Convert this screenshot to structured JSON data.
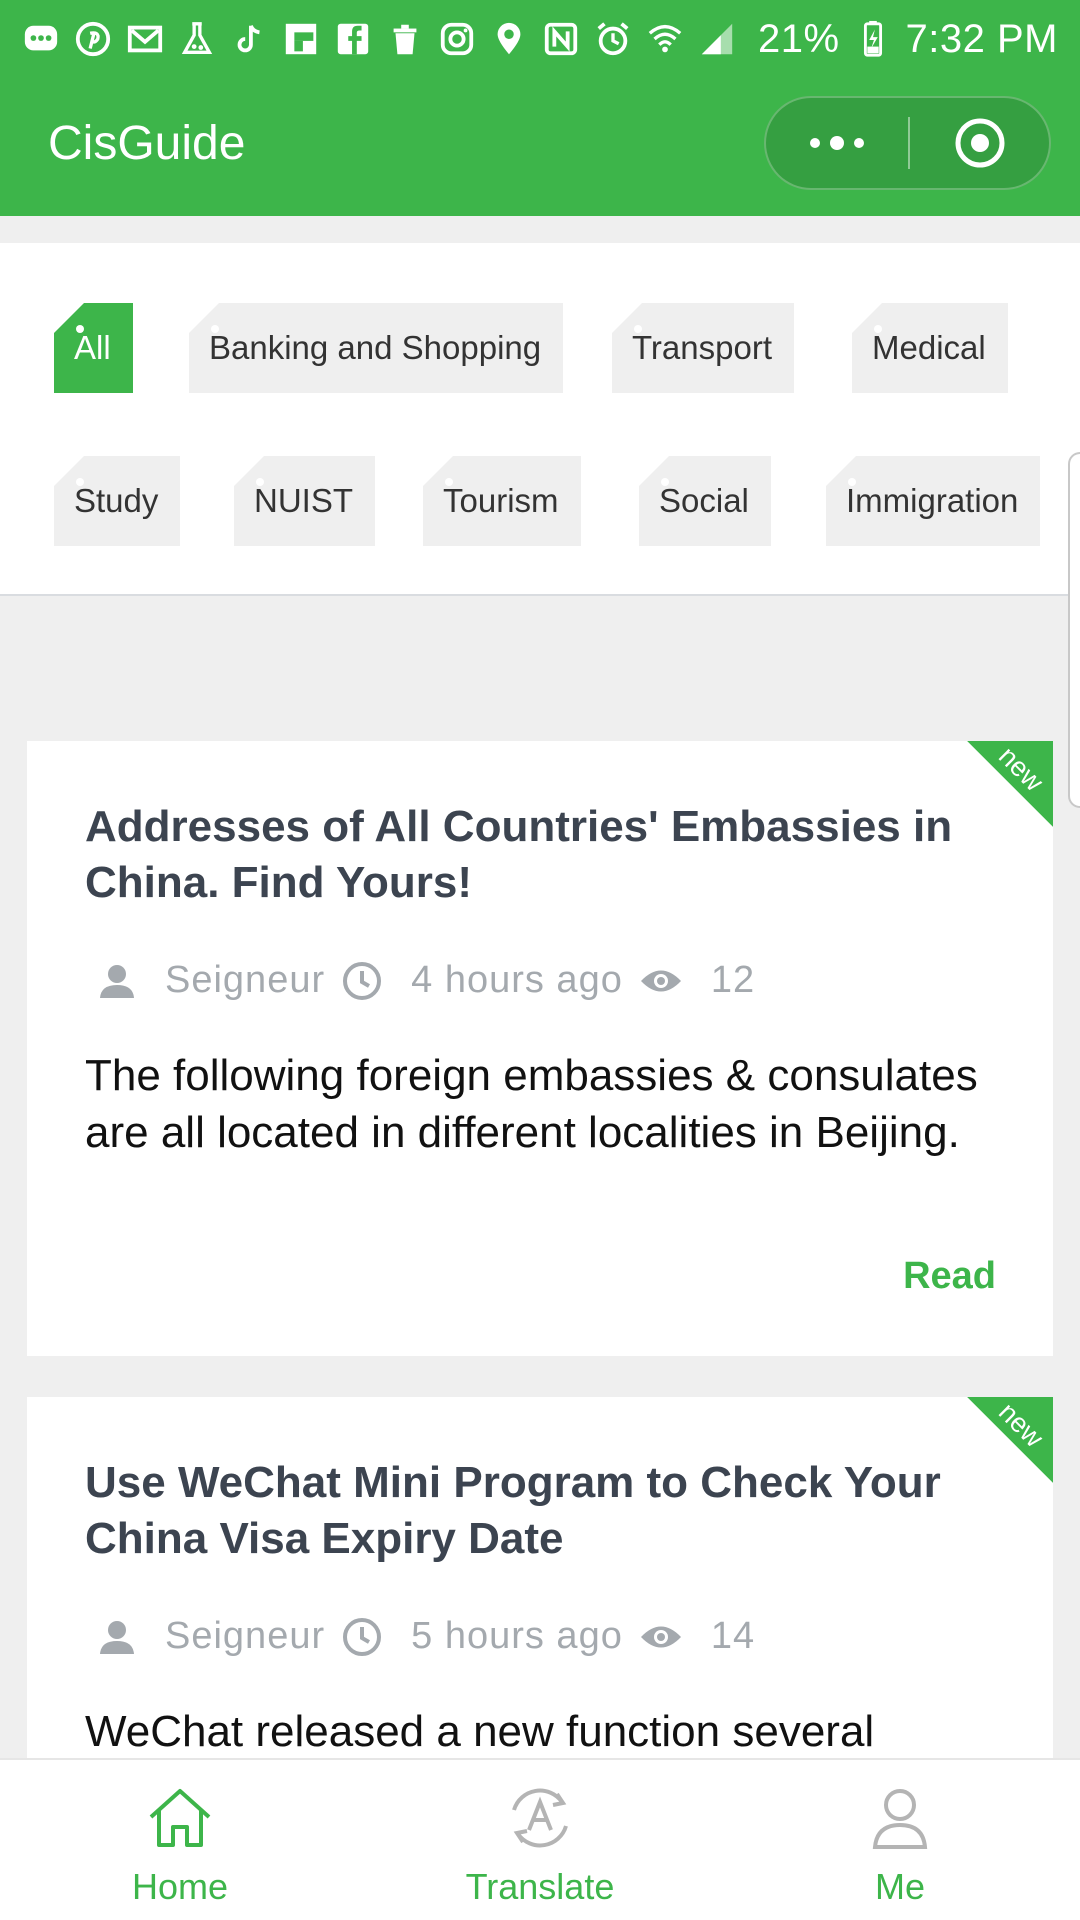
{
  "status_bar": {
    "battery": "21%",
    "time": "7:32 PM"
  },
  "header": {
    "title": "CisGuide"
  },
  "categories": [
    {
      "label": "All",
      "active": true
    },
    {
      "label": "Banking and Shopping",
      "active": false
    },
    {
      "label": "Transport",
      "active": false
    },
    {
      "label": "Medical",
      "active": false
    },
    {
      "label": "Study",
      "active": false
    },
    {
      "label": "NUIST",
      "active": false
    },
    {
      "label": "Tourism",
      "active": false
    },
    {
      "label": "Social",
      "active": false
    },
    {
      "label": "Immigration",
      "active": false
    }
  ],
  "articles": [
    {
      "title": "Addresses of All Countries' Embassies in China. Find Yours!",
      "author": "Seigneur",
      "time_ago": "4  hours  ago",
      "views": "12",
      "excerpt": "The following foreign embassies & consulates are all located in different localities in Beijing.",
      "read_label": "Read",
      "badge": "new"
    },
    {
      "title": "Use WeChat Mini Program to Check Your China Visa Expiry Date",
      "author": "Seigneur",
      "time_ago": "5  hours  ago",
      "views": "14",
      "excerpt": "WeChat released a new function several",
      "badge": "new"
    }
  ],
  "tab_bar": {
    "tabs": [
      {
        "label": "Home",
        "icon": "home-icon"
      },
      {
        "label": "Translate",
        "icon": "translate-icon"
      },
      {
        "label": "Me",
        "icon": "person-icon"
      }
    ]
  },
  "colors": {
    "brand": "#3db54a",
    "title_text": "#3c4450",
    "meta_text": "#a4a9ae"
  }
}
